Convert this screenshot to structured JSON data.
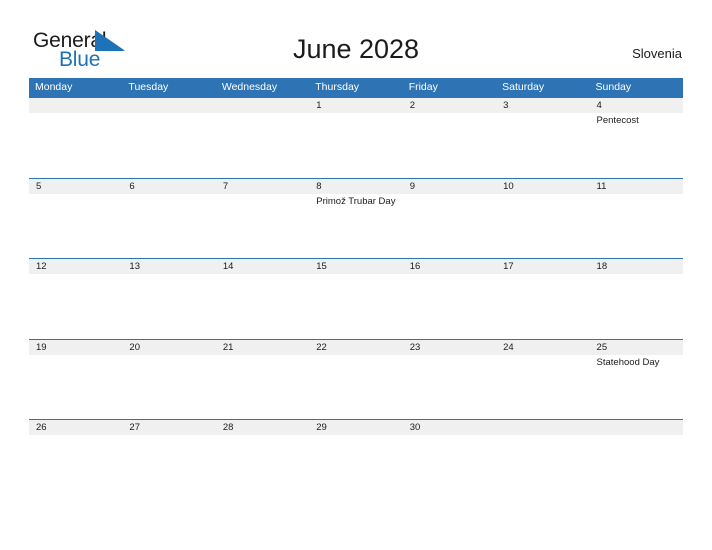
{
  "brand": {
    "name_part_1": "General",
    "name_part_2": "Blue",
    "logo_mark_color": "#1d72b8",
    "text_color": "#1b1b1b"
  },
  "header": {
    "title": "June 2028",
    "country": "Slovenia"
  },
  "colors": {
    "header_row_background": "#2e74b5",
    "header_row_text": "#ffffff",
    "date_band_background": "#f0f0f0",
    "row_divider": "#2e74b5",
    "page_background": "#ffffff",
    "body_text": "#1b1b1b"
  },
  "calendar": {
    "weekdays": [
      "Monday",
      "Tuesday",
      "Wednesday",
      "Thursday",
      "Friday",
      "Saturday",
      "Sunday"
    ],
    "weeks": [
      [
        {
          "day": "",
          "event": ""
        },
        {
          "day": "",
          "event": ""
        },
        {
          "day": "",
          "event": ""
        },
        {
          "day": "1",
          "event": ""
        },
        {
          "day": "2",
          "event": ""
        },
        {
          "day": "3",
          "event": ""
        },
        {
          "day": "4",
          "event": "Pentecost"
        }
      ],
      [
        {
          "day": "5",
          "event": ""
        },
        {
          "day": "6",
          "event": ""
        },
        {
          "day": "7",
          "event": ""
        },
        {
          "day": "8",
          "event": "Primož Trubar Day"
        },
        {
          "day": "9",
          "event": ""
        },
        {
          "day": "10",
          "event": ""
        },
        {
          "day": "11",
          "event": ""
        }
      ],
      [
        {
          "day": "12",
          "event": ""
        },
        {
          "day": "13",
          "event": ""
        },
        {
          "day": "14",
          "event": ""
        },
        {
          "day": "15",
          "event": ""
        },
        {
          "day": "16",
          "event": ""
        },
        {
          "day": "17",
          "event": ""
        },
        {
          "day": "18",
          "event": ""
        }
      ],
      [
        {
          "day": "19",
          "event": ""
        },
        {
          "day": "20",
          "event": ""
        },
        {
          "day": "21",
          "event": ""
        },
        {
          "day": "22",
          "event": ""
        },
        {
          "day": "23",
          "event": ""
        },
        {
          "day": "24",
          "event": ""
        },
        {
          "day": "25",
          "event": "Statehood Day"
        }
      ],
      [
        {
          "day": "26",
          "event": ""
        },
        {
          "day": "27",
          "event": ""
        },
        {
          "day": "28",
          "event": ""
        },
        {
          "day": "29",
          "event": ""
        },
        {
          "day": "30",
          "event": ""
        },
        {
          "day": "",
          "event": ""
        },
        {
          "day": "",
          "event": ""
        }
      ]
    ]
  }
}
